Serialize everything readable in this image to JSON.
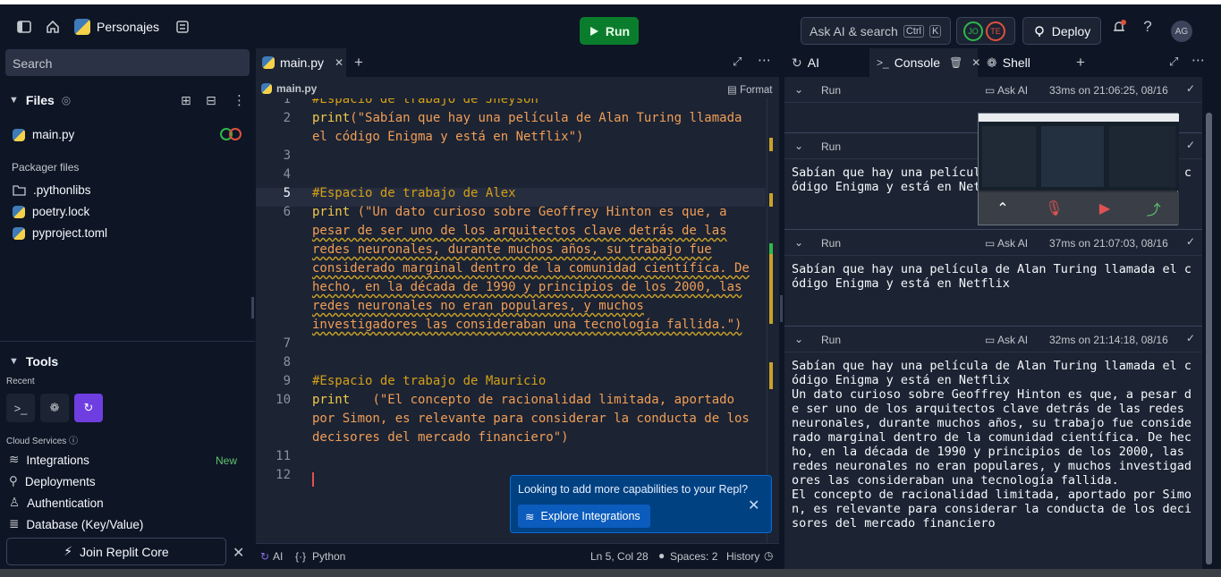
{
  "topbar": {
    "repl_name": "Personajes",
    "run_label": "Run",
    "ask_placeholder": "Ask AI & search",
    "kbd_ctrl": "Ctrl",
    "kbd_k": "K",
    "avatar_jo": "JO",
    "avatar_te": "TE",
    "deploy_label": "Deploy",
    "user_initials": "AG",
    "help_icon": "?"
  },
  "sidebar": {
    "search_placeholder": "Search",
    "files_title": "Files",
    "files": [
      {
        "name": "main.py",
        "icon": "python-icon"
      }
    ],
    "packager_label": "Packager files",
    "packager_files": [
      {
        "name": ".pythonlibs",
        "icon": "folder-icon"
      },
      {
        "name": "poetry.lock",
        "icon": "python-icon"
      },
      {
        "name": "pyproject.toml",
        "icon": "python-icon"
      }
    ],
    "tools_title": "Tools",
    "recent_label": "Recent",
    "cloud_label": "Cloud Services",
    "cloud_items": [
      {
        "label": "Integrations",
        "icon": "layers-icon"
      },
      {
        "label": "Deployments",
        "icon": "deploy-icon"
      },
      {
        "label": "Authentication",
        "icon": "user-icon"
      },
      {
        "label": "Database (Key/Value)",
        "icon": "database-icon"
      }
    ],
    "new_badge": "New",
    "join_label": "Join Replit Core"
  },
  "editor": {
    "tab_label": "main.py",
    "breadcrumb": "main.py",
    "format_label": "Format",
    "lines": [
      {
        "n": "1",
        "text": "#Espacio de trabajo de Jheyson",
        "type": "comment"
      },
      {
        "n": "2",
        "text": "print(\"Sabían que hay una película de Alan Turing llamada"
      },
      {
        "n": "",
        "text": "el código Enigma y está en Netflix\")"
      },
      {
        "n": "3",
        "text": ""
      },
      {
        "n": "4",
        "text": ""
      },
      {
        "n": "5",
        "text": "#Espacio de trabajo de Alex",
        "type": "comment"
      },
      {
        "n": "6",
        "text": "print (\"Un dato curioso sobre Geoffrey Hinton es que, a"
      },
      {
        "n": "",
        "text": "pesar de ser uno de los arquitectos clave detrás de las"
      },
      {
        "n": "",
        "text": "redes neuronales, durante muchos años, su trabajo fue"
      },
      {
        "n": "",
        "text": "considerado marginal dentro de la comunidad científica. De"
      },
      {
        "n": "",
        "text": "hecho, en la década de 1990 y principios de los 2000, las"
      },
      {
        "n": "",
        "text": "redes neuronales no eran populares, y muchos"
      },
      {
        "n": "",
        "text": "investigadores las consideraban una tecnología fallida.\")"
      },
      {
        "n": "7",
        "text": ""
      },
      {
        "n": "8",
        "text": ""
      },
      {
        "n": "9",
        "text": "#Espacio de trabajo de Mauricio",
        "type": "comment"
      },
      {
        "n": "10",
        "text": "print   (\"El concepto de racionalidad limitada, aportado"
      },
      {
        "n": "",
        "text": "por Simon, es relevante para considerar la conducta de los"
      },
      {
        "n": "",
        "text": "decisores del mercado financiero\")"
      },
      {
        "n": "11",
        "text": ""
      },
      {
        "n": "12",
        "text": ""
      }
    ],
    "status": {
      "ai": "AI",
      "lang": "Python",
      "position": "Ln 5, Col 28",
      "spaces": "Spaces: 2",
      "history": "History"
    },
    "popup": {
      "title": "Looking to add more capabilities to your Repl?",
      "button": "Explore Integrations"
    }
  },
  "console": {
    "tabs": [
      {
        "label": "AI",
        "icon": "ai-icon"
      },
      {
        "label": "Console",
        "icon": "terminal-icon"
      },
      {
        "label": "Shell",
        "icon": "shell-icon"
      }
    ],
    "entries": [
      {
        "run": "Run",
        "ask": "Ask AI",
        "time": "33ms on 21:06:25, 08/16",
        "output": ""
      },
      {
        "run": "Run",
        "ask": "Ask AI",
        "time": "",
        "output": "Sabían que hay una película de Alan Turing llamada el c\nódigo Enigma y está en Netflix"
      },
      {
        "run": "Run",
        "ask": "Ask AI",
        "time": "37ms on 21:07:03, 08/16",
        "output": "Sabían que hay una película de Alan Turing llamada el c\nódigo Enigma y está en Netflix"
      },
      {
        "run": "Run",
        "ask": "Ask AI",
        "time": "32ms on 21:14:18, 08/16",
        "output": "Sabían que hay una película de Alan Turing llamada el c\nódigo Enigma y está en Netflix\nUn dato curioso sobre Geoffrey Hinton es que, a pesar d\ne ser uno de los arquitectos clave detrás de las redes\nneuronales, durante muchos años, su trabajo fue conside\nrado marginal dentro de la comunidad científica. De hec\nho, en la década de 1990 y principios de los 2000, las\nredes neuronales no eran populares, y muchos investigad\nores las consideraban una tecnología fallida.\nEl concepto de racionalidad limitada, aportado por Simo\nn, es relevante para considerar la conducta de los deci\nsores del mercado financiero"
      }
    ]
  }
}
